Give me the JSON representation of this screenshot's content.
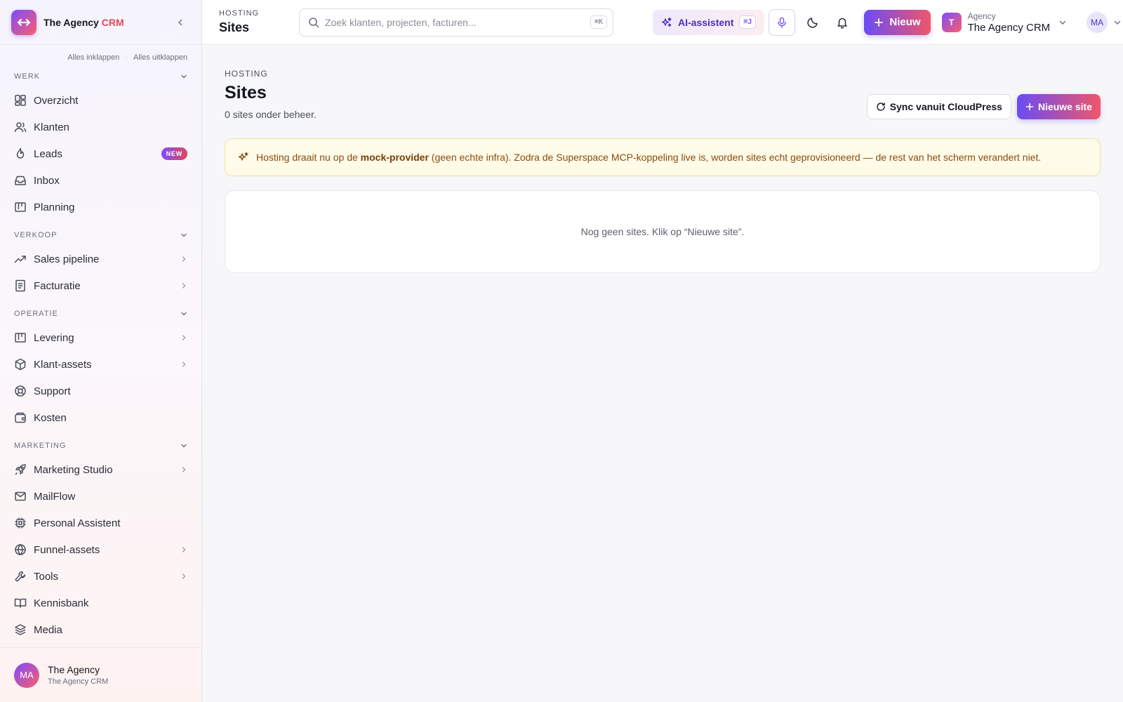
{
  "app": {
    "brand_main": "The Agency ",
    "brand_accent": "CRM",
    "accent_color": "#7c4dff",
    "accent_color_2": "#ff5c6a"
  },
  "sidebar": {
    "collapse_all": "Alles inklappen",
    "expand_all": "Alles uitklappen",
    "sections": [
      {
        "title": "WERK",
        "items": [
          {
            "label": "Overzicht",
            "icon": "dashboard-icon"
          },
          {
            "label": "Klanten",
            "icon": "users-icon"
          },
          {
            "label": "Leads",
            "icon": "flame-icon",
            "badge": "NEW"
          },
          {
            "label": "Inbox",
            "icon": "inbox-icon"
          },
          {
            "label": "Planning",
            "icon": "kanban-icon"
          }
        ]
      },
      {
        "title": "VERKOOP",
        "items": [
          {
            "label": "Sales pipeline",
            "icon": "trending-up-icon",
            "submenu": true
          },
          {
            "label": "Facturatie",
            "icon": "invoice-icon",
            "submenu": true
          }
        ]
      },
      {
        "title": "OPERATIE",
        "items": [
          {
            "label": "Levering",
            "icon": "kanban-icon",
            "submenu": true
          },
          {
            "label": "Klant-assets",
            "icon": "box-icon",
            "submenu": true
          },
          {
            "label": "Support",
            "icon": "lifebuoy-icon"
          },
          {
            "label": "Kosten",
            "icon": "wallet-icon"
          }
        ]
      },
      {
        "title": "MARKETING",
        "items": [
          {
            "label": "Marketing Studio",
            "icon": "rocket-icon",
            "submenu": true
          },
          {
            "label": "MailFlow",
            "icon": "mail-icon"
          },
          {
            "label": "Personal Assistent",
            "icon": "chip-icon"
          },
          {
            "label": "Funnel-assets",
            "icon": "globe-icon",
            "submenu": true
          },
          {
            "label": "Tools",
            "icon": "wrench-icon",
            "submenu": true
          },
          {
            "label": "Kennisbank",
            "icon": "book-icon"
          },
          {
            "label": "Media",
            "icon": "layers-icon"
          }
        ]
      }
    ],
    "footer": {
      "initials": "MA",
      "name": "The Agency",
      "sub": "The Agency CRM"
    }
  },
  "topbar": {
    "kicker": "HOSTING",
    "title": "Sites",
    "search_placeholder": "Zoek klanten, projecten, facturen...",
    "search_shortcut": "⌘K",
    "ai_label": "AI-assistent",
    "ai_shortcut": "⌘J",
    "new_label": "Nieuw",
    "workspace_initial": "T",
    "workspace_kicker": "Agency",
    "workspace_name": "The Agency CRM",
    "user_initials": "MA"
  },
  "page": {
    "kicker": "HOSTING",
    "title": "Sites",
    "subtitle": "0 sites onder beheer.",
    "sync_label": "Sync vanuit CloudPress",
    "new_site_label": "Nieuwe site",
    "notice_before": "Hosting draait nu op de ",
    "notice_bold": "mock-provider",
    "notice_after": " (geen echte infra). Zodra de Superspace MCP-koppeling live is, worden sites echt geprovisioneerd — de rest van het scherm verandert niet.",
    "empty_text": "Nog geen sites. Klik op “Nieuwe site”."
  }
}
